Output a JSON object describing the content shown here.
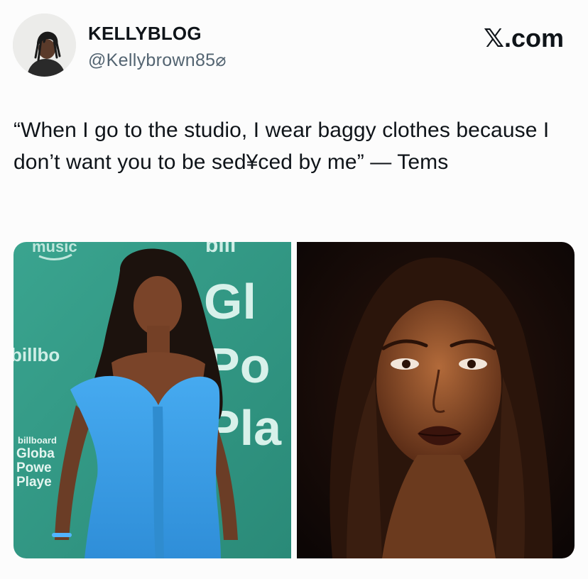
{
  "post": {
    "author": {
      "display_name": "KELLYBLOG",
      "handle": "@Kellybrown85⌀"
    },
    "brand": "𝕏.com",
    "text": "“When I go to the studio, I wear baggy clothes because I don’t want you to be sed¥ced by me” — Tems"
  },
  "media": {
    "left_photo": {
      "backdrop_text": {
        "music": "music",
        "billboard_top": "bill",
        "billboard_side": "billbo",
        "global_1": "Gl",
        "global_2": "Po",
        "global_3": "Pla",
        "small_brand": "billboard",
        "small_1": "Globa",
        "small_2": "Powe",
        "small_3": "Playe"
      }
    }
  },
  "colors": {
    "backdrop_green": "#2f9a86",
    "dress_blue": "#3aa0e4",
    "text_primary": "#0f1419",
    "text_secondary": "#536471"
  }
}
